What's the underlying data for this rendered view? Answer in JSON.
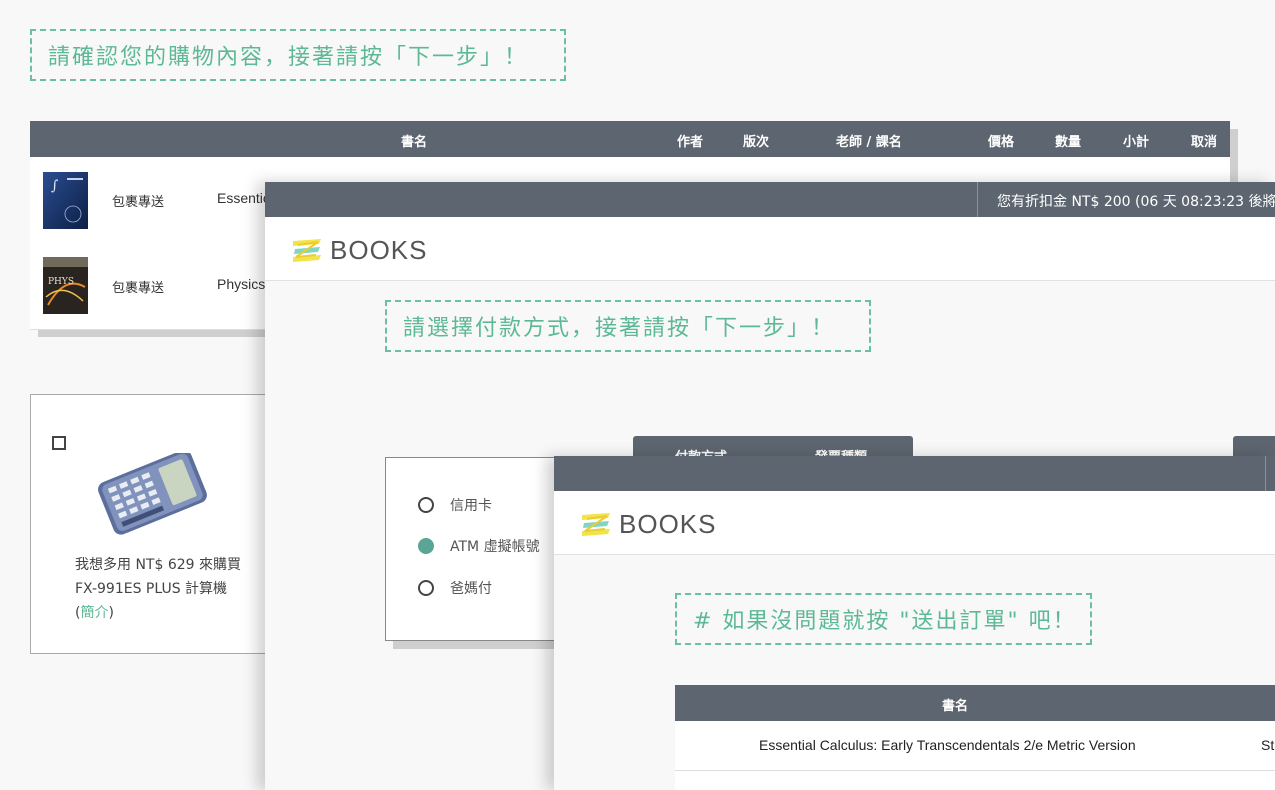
{
  "step1": {
    "instruction": "請確認您的購物內容，接著請按「下一步」！",
    "table_headers": {
      "title": "書名",
      "author": "作者",
      "edition": "版次",
      "teacher_course": "老師 / 課名",
      "price": "價格",
      "quantity": "數量",
      "subtotal": "小計",
      "cancel": "取消"
    },
    "rows": [
      {
        "shipping": "包裹專送",
        "title": "Essentic"
      },
      {
        "shipping": "包裹專送",
        "title": "Physics"
      }
    ],
    "addon": {
      "text": "我想多用 NT$ 629 來購買 FX-991ES PLUS 計算機 (",
      "link": "簡介",
      "close_paren": ")"
    }
  },
  "step2": {
    "discount_text": "您有折扣金 NT$ 200 (06 天 08:23:23 後將",
    "logo": "BOOKS",
    "instruction": "請選擇付款方式，接著請按「下一步」！",
    "tabs": [
      "付款方式",
      "發票種類"
    ],
    "payment_options": [
      {
        "label": "信用卡",
        "selected": false
      },
      {
        "label": "ATM 虛擬帳號",
        "selected": true
      },
      {
        "label": "爸媽付",
        "selected": false
      }
    ]
  },
  "step3": {
    "logo": "BOOKS",
    "instruction": "# 如果沒問題就按 \"送出訂單\" 吧！",
    "table_header": "書名",
    "rows": [
      {
        "title": "Essential Calculus: Early Transcendentals 2/e Metric Version",
        "extra": "St"
      }
    ]
  },
  "colors": {
    "accent_green": "#5cb895",
    "dark_bar": "#5d6670",
    "radio_selected": "#5aa596"
  },
  "icons": [
    "books-logo-icon",
    "checkbox-icon",
    "radio-icon",
    "calculator-image",
    "book-cover-image"
  ]
}
